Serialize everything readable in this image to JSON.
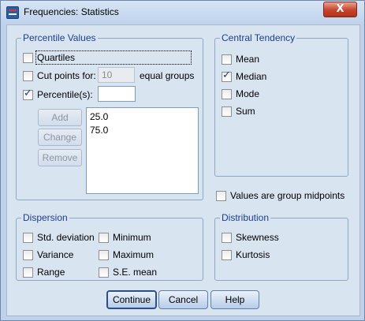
{
  "window": {
    "title": "Frequencies: Statistics",
    "close_label": "X"
  },
  "percentile_values": {
    "legend": "Percentile Values",
    "quartiles": {
      "label": "Quartiles",
      "checked": false
    },
    "cut_points": {
      "label": "Cut points for:",
      "value": "10",
      "suffix": "equal groups",
      "checked": false
    },
    "percentiles": {
      "label": "Percentile(s):",
      "value": "",
      "checked": true
    },
    "buttons": {
      "add": "Add",
      "change": "Change",
      "remove": "Remove"
    },
    "list": [
      "25.0",
      "75.0"
    ]
  },
  "central_tendency": {
    "legend": "Central Tendency",
    "items": [
      {
        "label": "Mean",
        "checked": false
      },
      {
        "label": "Median",
        "checked": true
      },
      {
        "label": "Mode",
        "checked": false
      },
      {
        "label": "Sum",
        "checked": false
      }
    ]
  },
  "group_midpoints": {
    "label": "Values are group midpoints",
    "checked": false
  },
  "dispersion": {
    "legend": "Dispersion",
    "items": [
      {
        "label": "Std. deviation",
        "checked": false
      },
      {
        "label": "Minimum",
        "checked": false
      },
      {
        "label": "Variance",
        "checked": false
      },
      {
        "label": "Maximum",
        "checked": false
      },
      {
        "label": "Range",
        "checked": false
      },
      {
        "label": "S.E. mean",
        "checked": false
      }
    ]
  },
  "distribution": {
    "legend": "Distribution",
    "items": [
      {
        "label": "Skewness",
        "checked": false
      },
      {
        "label": "Kurtosis",
        "checked": false
      }
    ]
  },
  "footer": {
    "continue": "Continue",
    "cancel": "Cancel",
    "help": "Help"
  }
}
